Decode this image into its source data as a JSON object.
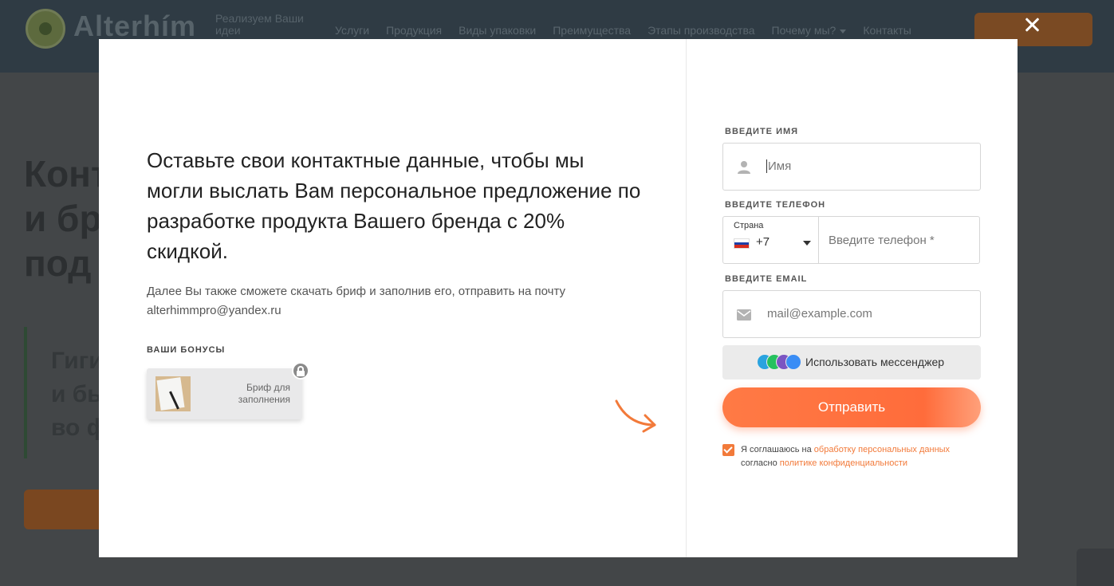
{
  "site": {
    "logo_text": "Alterhím",
    "tagline": "Реализуем Ваши идеи",
    "nav": [
      "Услуги",
      "Продукция",
      "Виды упаковки",
      "Преимущества",
      "Этапы производства",
      "Почему мы?",
      "Контакты"
    ],
    "hero_heading": [
      "Конт",
      "и бр",
      "под "
    ],
    "hero_sub": [
      "Гиги",
      "и бы",
      "во ф"
    ]
  },
  "modal": {
    "headline": "Оставьте свои контактные данные, чтобы мы могли выслать Вам персональное предложение по разработке продукта Вашего бренда с 20% скидкой.",
    "subtext": "Далее Вы также сможете скачать бриф и заполнив его, отправить на почту alterhimmpro@yandex.ru",
    "bonus_title": "ВАШИ БОНУСЫ",
    "bonus_card_label": "Бриф для заполнения",
    "form": {
      "name_label": "ВВЕДИТЕ ИМЯ",
      "name_placeholder": "Имя",
      "phone_label": "ВВЕДИТЕ ТЕЛЕФОН",
      "country_caption": "Страна",
      "dial_code": "+7",
      "phone_placeholder": "Введите телефон *",
      "email_label": "ВВЕДИТЕ EMAIL",
      "email_placeholder": "mail@example.com",
      "messenger_label": "Использовать мессенджер",
      "submit_label": "Отправить",
      "consent_prefix": "Я соглашаюсь на ",
      "consent_link_1": "обработку персональных данных",
      "consent_middle": "согласно ",
      "consent_link_2": "политике конфиденциальности"
    }
  },
  "colors": {
    "accent": "#f27a3a",
    "submit": "#ff6c3b",
    "overlay": "#3e4347"
  }
}
